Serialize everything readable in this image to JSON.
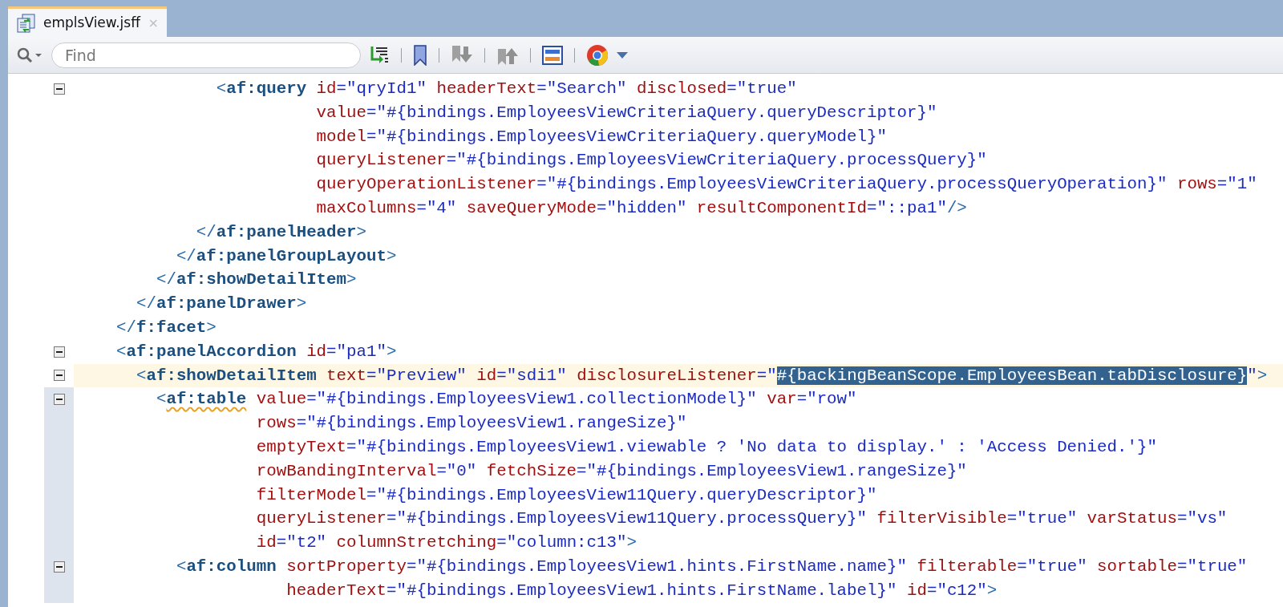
{
  "editor_tab": {
    "title": "emplsView.jsff",
    "close": "×",
    "selected": true
  },
  "toolbar": {
    "search": {
      "placeholder": "Find"
    }
  },
  "code_lines": [
    {
      "foldable": true,
      "current": false,
      "scope": false,
      "segments": [
        {
          "kind": "punct",
          "text": "          <"
        },
        {
          "kind": "tag",
          "text": "af:query"
        },
        {
          "kind": "attr",
          "text": " id"
        },
        {
          "kind": "value",
          "text": "=\"qryId1\""
        },
        {
          "kind": "attr",
          "text": " headerText"
        },
        {
          "kind": "value",
          "text": "=\"Search\""
        },
        {
          "kind": "attr",
          "text": " disclosed"
        },
        {
          "kind": "value",
          "text": "=\"true\""
        }
      ]
    },
    {
      "foldable": false,
      "current": false,
      "scope": false,
      "segments": [
        {
          "kind": "attr",
          "text": "                    value"
        },
        {
          "kind": "value",
          "text": "=\"#{bindings.EmployeesViewCriteriaQuery.queryDescriptor}\""
        }
      ]
    },
    {
      "foldable": false,
      "current": false,
      "scope": false,
      "segments": [
        {
          "kind": "attr",
          "text": "                    model"
        },
        {
          "kind": "value",
          "text": "=\"#{bindings.EmployeesViewCriteriaQuery.queryModel}\""
        }
      ]
    },
    {
      "foldable": false,
      "current": false,
      "scope": false,
      "segments": [
        {
          "kind": "attr",
          "text": "                    queryListener"
        },
        {
          "kind": "value",
          "text": "=\"#{bindings.EmployeesViewCriteriaQuery.processQuery}\""
        }
      ]
    },
    {
      "foldable": false,
      "current": false,
      "scope": false,
      "segments": [
        {
          "kind": "attr",
          "text": "                    queryOperationListener"
        },
        {
          "kind": "value",
          "text": "=\"#{bindings.EmployeesViewCriteriaQuery.processQueryOperation}\""
        },
        {
          "kind": "attr",
          "text": " rows"
        },
        {
          "kind": "value",
          "text": "=\"1\""
        }
      ]
    },
    {
      "foldable": false,
      "current": false,
      "scope": false,
      "segments": [
        {
          "kind": "attr",
          "text": "                    maxColumns"
        },
        {
          "kind": "value",
          "text": "=\"4\""
        },
        {
          "kind": "attr",
          "text": " saveQueryMode"
        },
        {
          "kind": "value",
          "text": "=\"hidden\""
        },
        {
          "kind": "attr",
          "text": " resultComponentId"
        },
        {
          "kind": "value",
          "text": "=\"::pa1\""
        },
        {
          "kind": "punct",
          "text": "/>"
        }
      ]
    },
    {
      "foldable": false,
      "current": false,
      "scope": false,
      "segments": [
        {
          "kind": "punct",
          "text": "        </"
        },
        {
          "kind": "tag",
          "text": "af:panelHeader"
        },
        {
          "kind": "punct",
          "text": ">"
        }
      ]
    },
    {
      "foldable": false,
      "current": false,
      "scope": false,
      "segments": [
        {
          "kind": "punct",
          "text": "      </"
        },
        {
          "kind": "tag",
          "text": "af:panelGroupLayout"
        },
        {
          "kind": "punct",
          "text": ">"
        }
      ]
    },
    {
      "foldable": false,
      "current": false,
      "scope": false,
      "segments": [
        {
          "kind": "punct",
          "text": "    </"
        },
        {
          "kind": "tag",
          "text": "af:showDetailItem"
        },
        {
          "kind": "punct",
          "text": ">"
        }
      ]
    },
    {
      "foldable": false,
      "current": false,
      "scope": false,
      "segments": [
        {
          "kind": "punct",
          "text": "  </"
        },
        {
          "kind": "tag",
          "text": "af:panelDrawer"
        },
        {
          "kind": "punct",
          "text": ">"
        }
      ]
    },
    {
      "foldable": false,
      "current": false,
      "scope": false,
      "segments": [
        {
          "kind": "punct",
          "text": "</"
        },
        {
          "kind": "tag",
          "text": "f:facet"
        },
        {
          "kind": "punct",
          "text": ">"
        }
      ]
    },
    {
      "foldable": true,
      "current": false,
      "scope": false,
      "segments": [
        {
          "kind": "punct",
          "text": "<"
        },
        {
          "kind": "tag",
          "text": "af:panelAccordion"
        },
        {
          "kind": "attr",
          "text": " id"
        },
        {
          "kind": "value",
          "text": "=\"pa1\""
        },
        {
          "kind": "punct",
          "text": ">"
        }
      ]
    },
    {
      "foldable": true,
      "current": true,
      "scope": false,
      "segments": [
        {
          "kind": "punct",
          "text": "  <"
        },
        {
          "kind": "tag",
          "text": "af:showDetailItem"
        },
        {
          "kind": "attr",
          "text": " text"
        },
        {
          "kind": "value",
          "text": "=\"Preview\""
        },
        {
          "kind": "attr",
          "text": " id"
        },
        {
          "kind": "value",
          "text": "=\"sdi1\""
        },
        {
          "kind": "attr",
          "text": " disclosureListener"
        },
        {
          "kind": "value",
          "text": "=\""
        },
        {
          "kind": "selected",
          "text": "#{backingBeanScope.EmployeesBean.tabDisclosure}"
        },
        {
          "kind": "value",
          "text": "\""
        },
        {
          "kind": "punct",
          "text": ">"
        }
      ]
    },
    {
      "foldable": true,
      "current": false,
      "scope": true,
      "segments": [
        {
          "kind": "punct",
          "text": "    <"
        },
        {
          "kind": "tag",
          "text": "af:table",
          "warning": true
        },
        {
          "kind": "attr",
          "text": " value"
        },
        {
          "kind": "value",
          "text": "=\"#{bindings.EmployeesView1.collectionModel}\""
        },
        {
          "kind": "attr",
          "text": " var"
        },
        {
          "kind": "value",
          "text": "=\"row\""
        }
      ]
    },
    {
      "foldable": false,
      "current": false,
      "scope": true,
      "segments": [
        {
          "kind": "attr",
          "text": "              rows"
        },
        {
          "kind": "value",
          "text": "=\"#{bindings.EmployeesView1.rangeSize}\""
        }
      ]
    },
    {
      "foldable": false,
      "current": false,
      "scope": true,
      "segments": [
        {
          "kind": "attr",
          "text": "              emptyText"
        },
        {
          "kind": "value",
          "text": "=\"#{bindings.EmployeesView1.viewable ? 'No data to display.' : 'Access Denied.'}\""
        }
      ]
    },
    {
      "foldable": false,
      "current": false,
      "scope": true,
      "segments": [
        {
          "kind": "attr",
          "text": "              rowBandingInterval"
        },
        {
          "kind": "value",
          "text": "=\"0\""
        },
        {
          "kind": "attr",
          "text": " fetchSize"
        },
        {
          "kind": "value",
          "text": "=\"#{bindings.EmployeesView1.rangeSize}\""
        }
      ]
    },
    {
      "foldable": false,
      "current": false,
      "scope": true,
      "segments": [
        {
          "kind": "attr",
          "text": "              filterModel"
        },
        {
          "kind": "value",
          "text": "=\"#{bindings.EmployeesView11Query.queryDescriptor}\""
        }
      ]
    },
    {
      "foldable": false,
      "current": false,
      "scope": true,
      "segments": [
        {
          "kind": "attr",
          "text": "              queryListener"
        },
        {
          "kind": "value",
          "text": "=\"#{bindings.EmployeesView11Query.processQuery}\""
        },
        {
          "kind": "attr",
          "text": " filterVisible"
        },
        {
          "kind": "value",
          "text": "=\"true\""
        },
        {
          "kind": "attr",
          "text": " varStatus"
        },
        {
          "kind": "value",
          "text": "=\"vs\""
        }
      ]
    },
    {
      "foldable": false,
      "current": false,
      "scope": true,
      "segments": [
        {
          "kind": "attr",
          "text": "              id"
        },
        {
          "kind": "value",
          "text": "=\"t2\""
        },
        {
          "kind": "attr",
          "text": " columnStretching"
        },
        {
          "kind": "value",
          "text": "=\"column:c13\""
        },
        {
          "kind": "punct",
          "text": ">"
        }
      ]
    },
    {
      "foldable": true,
      "current": false,
      "scope": true,
      "segments": [
        {
          "kind": "punct",
          "text": "      <"
        },
        {
          "kind": "tag",
          "text": "af:column"
        },
        {
          "kind": "attr",
          "text": " sortProperty"
        },
        {
          "kind": "value",
          "text": "=\"#{bindings.EmployeesView1.hints.FirstName.name}\""
        },
        {
          "kind": "attr",
          "text": " filterable"
        },
        {
          "kind": "value",
          "text": "=\"true\""
        },
        {
          "kind": "attr",
          "text": " sortable"
        },
        {
          "kind": "value",
          "text": "=\"true\""
        }
      ]
    },
    {
      "foldable": false,
      "current": false,
      "scope": true,
      "segments": [
        {
          "kind": "attr",
          "text": "                 headerText"
        },
        {
          "kind": "value",
          "text": "=\"#{bindings.EmployeesView1.hints.FirstName.label}\""
        },
        {
          "kind": "attr",
          "text": " id"
        },
        {
          "kind": "value",
          "text": "=\"c12\""
        },
        {
          "kind": "punct",
          "text": ">"
        }
      ]
    }
  ]
}
